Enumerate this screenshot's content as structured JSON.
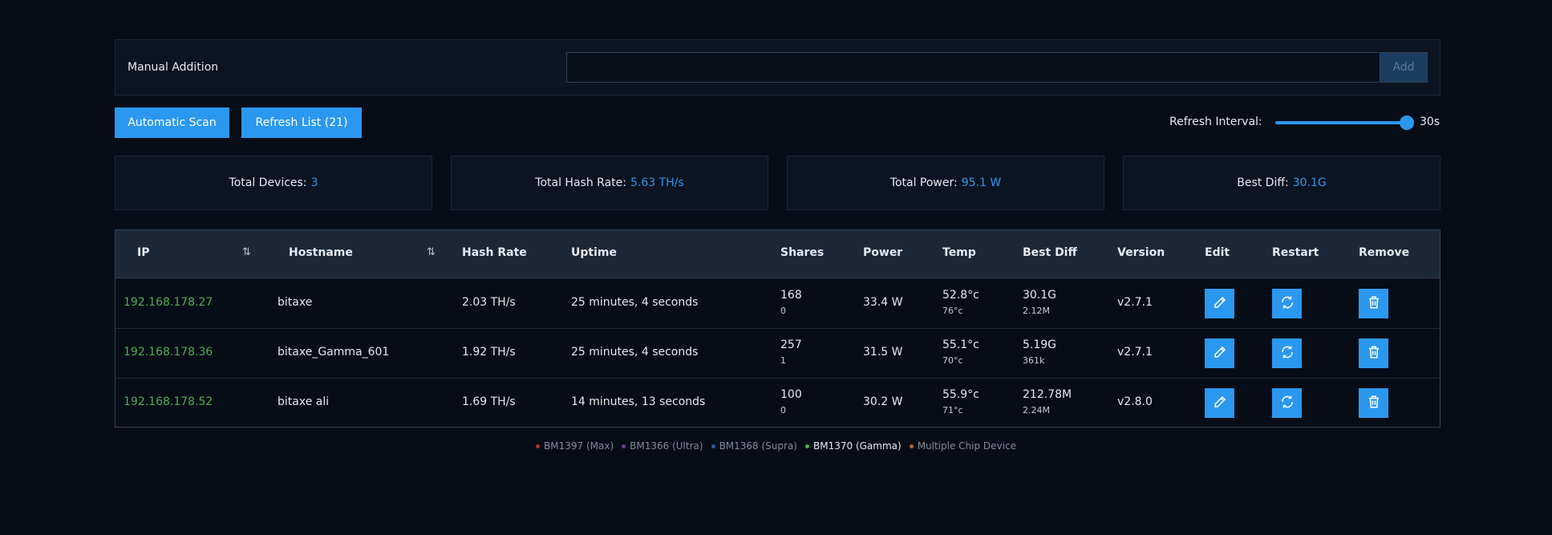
{
  "manual": {
    "label": "Manual Addition",
    "input_value": "",
    "add_label": "Add"
  },
  "toolbar": {
    "scan_label": "Automatic Scan",
    "refresh_label": "Refresh List (21)",
    "interval_label": "Refresh Interval:",
    "interval_value": "30s",
    "interval_fraction": 1.0
  },
  "stats": [
    {
      "label": "Total Devices:",
      "value": "3"
    },
    {
      "label": "Total Hash Rate:",
      "value": "5.63 TH/s"
    },
    {
      "label": "Total Power:",
      "value": "95.1 W"
    },
    {
      "label": "Best Diff:",
      "value": "30.1G"
    }
  ],
  "table": {
    "headers": {
      "ip": "IP",
      "hostname": "Hostname",
      "hashrate": "Hash Rate",
      "uptime": "Uptime",
      "shares": "Shares",
      "power": "Power",
      "temp": "Temp",
      "bestdiff": "Best Diff",
      "version": "Version",
      "edit": "Edit",
      "restart": "Restart",
      "remove": "Remove"
    },
    "rows": [
      {
        "ip": "192.168.178.27",
        "hostname": "bitaxe",
        "hashrate": "2.03 TH/s",
        "uptime": "25 minutes, 4 seconds",
        "shares": "168",
        "shares_rejected": "0",
        "power": "33.4 W",
        "temp": "52.8°c",
        "temp2": "76°c",
        "bestdiff": "30.1G",
        "bestdiff_session": "2.12M",
        "version": "v2.7.1"
      },
      {
        "ip": "192.168.178.36",
        "hostname": "bitaxe_Gamma_601",
        "hashrate": "1.92 TH/s",
        "uptime": "25 minutes, 4 seconds",
        "shares": "257",
        "shares_rejected": "1",
        "power": "31.5 W",
        "temp": "55.1°c",
        "temp2": "70°c",
        "bestdiff": "5.19G",
        "bestdiff_session": "361k",
        "version": "v2.7.1"
      },
      {
        "ip": "192.168.178.52",
        "hostname": "bitaxe ali",
        "hashrate": "1.69 TH/s",
        "uptime": "14 minutes, 13 seconds",
        "shares": "100",
        "shares_rejected": "0",
        "power": "30.2 W",
        "temp": "55.9°c",
        "temp2": "71°c",
        "bestdiff": "212.78M",
        "bestdiff_session": "2.24M",
        "version": "v2.8.0"
      }
    ]
  },
  "legend": [
    {
      "label": "BM1397 (Max)",
      "color": "#a33a3a",
      "active": false
    },
    {
      "label": "BM1366 (Ultra)",
      "color": "#6a3a8c",
      "active": false
    },
    {
      "label": "BM1368 (Supra)",
      "color": "#2f5aa8",
      "active": false
    },
    {
      "label": "BM1370 (Gamma)",
      "color": "#4caf50",
      "active": true
    },
    {
      "label": "Multiple Chip Device",
      "color": "#b8672a",
      "active": false
    }
  ],
  "colors": {
    "accent": "#2b98f0",
    "ip_green": "#4caf50",
    "background": "#070d17"
  }
}
